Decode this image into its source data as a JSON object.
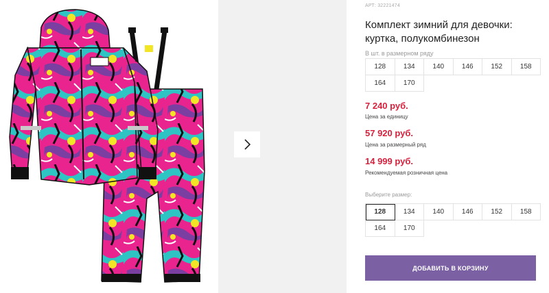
{
  "product": {
    "article": "АРТ: 32221474",
    "title": "Комплект зимний для девочки: куртка, полукомбинезон",
    "image_alt": "Комплект зимний для девочки"
  },
  "pack": {
    "label": "В шт. в размерном ряду",
    "sizes": [
      "128",
      "134",
      "140",
      "146",
      "152",
      "158",
      "164",
      "170"
    ]
  },
  "prices": {
    "unit_price": "7 240 руб.",
    "unit_note": "Цена за единицу",
    "row_price": "57 920 руб.",
    "row_note": "Цена за размерный ряд",
    "retail_price": "14 999 руб.",
    "retail_note": "Рекомендуемая розничная цена"
  },
  "size_select": {
    "label": "Выберите размер:",
    "sizes": [
      "128",
      "134",
      "140",
      "146",
      "152",
      "158",
      "164",
      "170"
    ],
    "selected": "128"
  },
  "actions": {
    "add_to_cart": "ДОБАВИТЬ В КОРЗИНУ"
  },
  "icons": {
    "gallery_next": "chevron-right-icon"
  },
  "colors": {
    "price": "#d6213d",
    "button": "#7b60a4",
    "side_panel": "#f1f1f1",
    "print_pink": "#e9248f",
    "print_teal": "#2ec4c4",
    "print_yellow": "#f2e526",
    "print_purple": "#7a3fa0"
  }
}
